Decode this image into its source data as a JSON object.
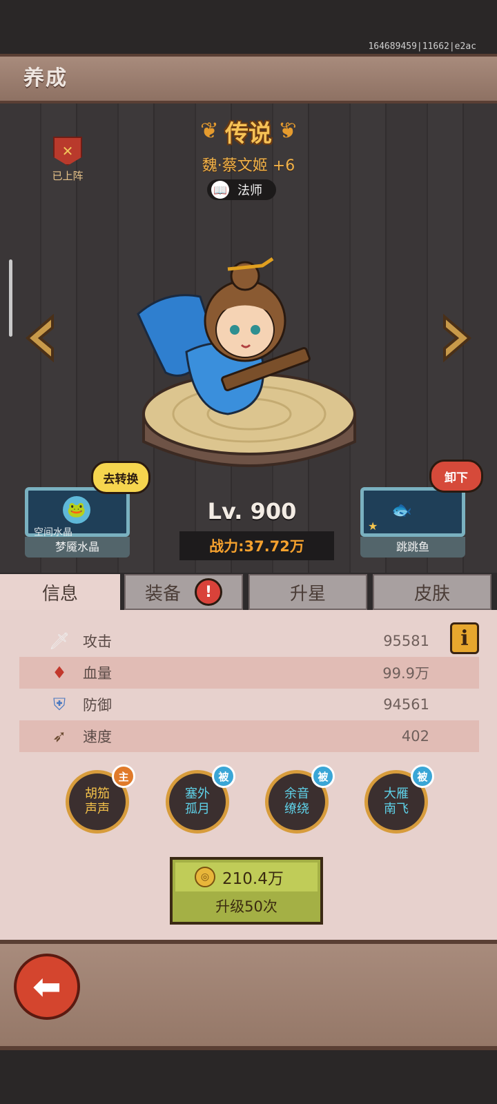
{
  "build_id": "164689459|11662|e2ac",
  "header": {
    "title": "养成"
  },
  "deployed": {
    "label": "已上阵",
    "icon": "crossed-swords-icon"
  },
  "hero": {
    "rarity": "传说",
    "name": "魏·蔡文姬 +6",
    "class_label": "法师",
    "class_icon": "book-icon"
  },
  "left_card": {
    "sub_label": "空间水晶",
    "name": "梦魇水晶",
    "action": "去转换",
    "icon": "crystal-frog-icon"
  },
  "right_card": {
    "name": "跳跳鱼",
    "action": "卸下",
    "icon": "fish-icon",
    "stars": 1
  },
  "level": "Lv. 900",
  "power": "战力:37.72万",
  "tabs": [
    {
      "label": "信息",
      "active": true
    },
    {
      "label": "装备",
      "alert": "!"
    },
    {
      "label": "升星"
    },
    {
      "label": "皮肤"
    }
  ],
  "stats": [
    {
      "label": "攻击",
      "value": "95581",
      "icon": "sword-icon"
    },
    {
      "label": "血量",
      "value": "99.9万",
      "icon": "blood-drop-icon"
    },
    {
      "label": "防御",
      "value": "94561",
      "icon": "shield-icon"
    },
    {
      "label": "速度",
      "value": "402",
      "icon": "boot-icon"
    }
  ],
  "info_button": "i",
  "skills": [
    {
      "name": "胡笳声声",
      "line1": "胡笳",
      "line2": "声声",
      "badge": "主",
      "badge_color": "#e07a2a",
      "text_color": "#f5c24a"
    },
    {
      "name": "塞外孤月",
      "line1": "塞外",
      "line2": "孤月",
      "badge": "被",
      "badge_color": "#3aa6d6",
      "text_color": "#5fd3ea"
    },
    {
      "name": "余音缭绕",
      "line1": "余音",
      "line2": "缭绕",
      "badge": "被",
      "badge_color": "#3aa6d6",
      "text_color": "#5fd3ea"
    },
    {
      "name": "大雁南飞",
      "line1": "大雁",
      "line2": "南飞",
      "badge": "被",
      "badge_color": "#3aa6d6",
      "text_color": "#5fd3ea"
    }
  ],
  "upgrade": {
    "cost": "210.4万",
    "label": "升级50次",
    "icon": "coin-icon"
  },
  "back_button": {
    "icon": "back-arrow-icon"
  }
}
